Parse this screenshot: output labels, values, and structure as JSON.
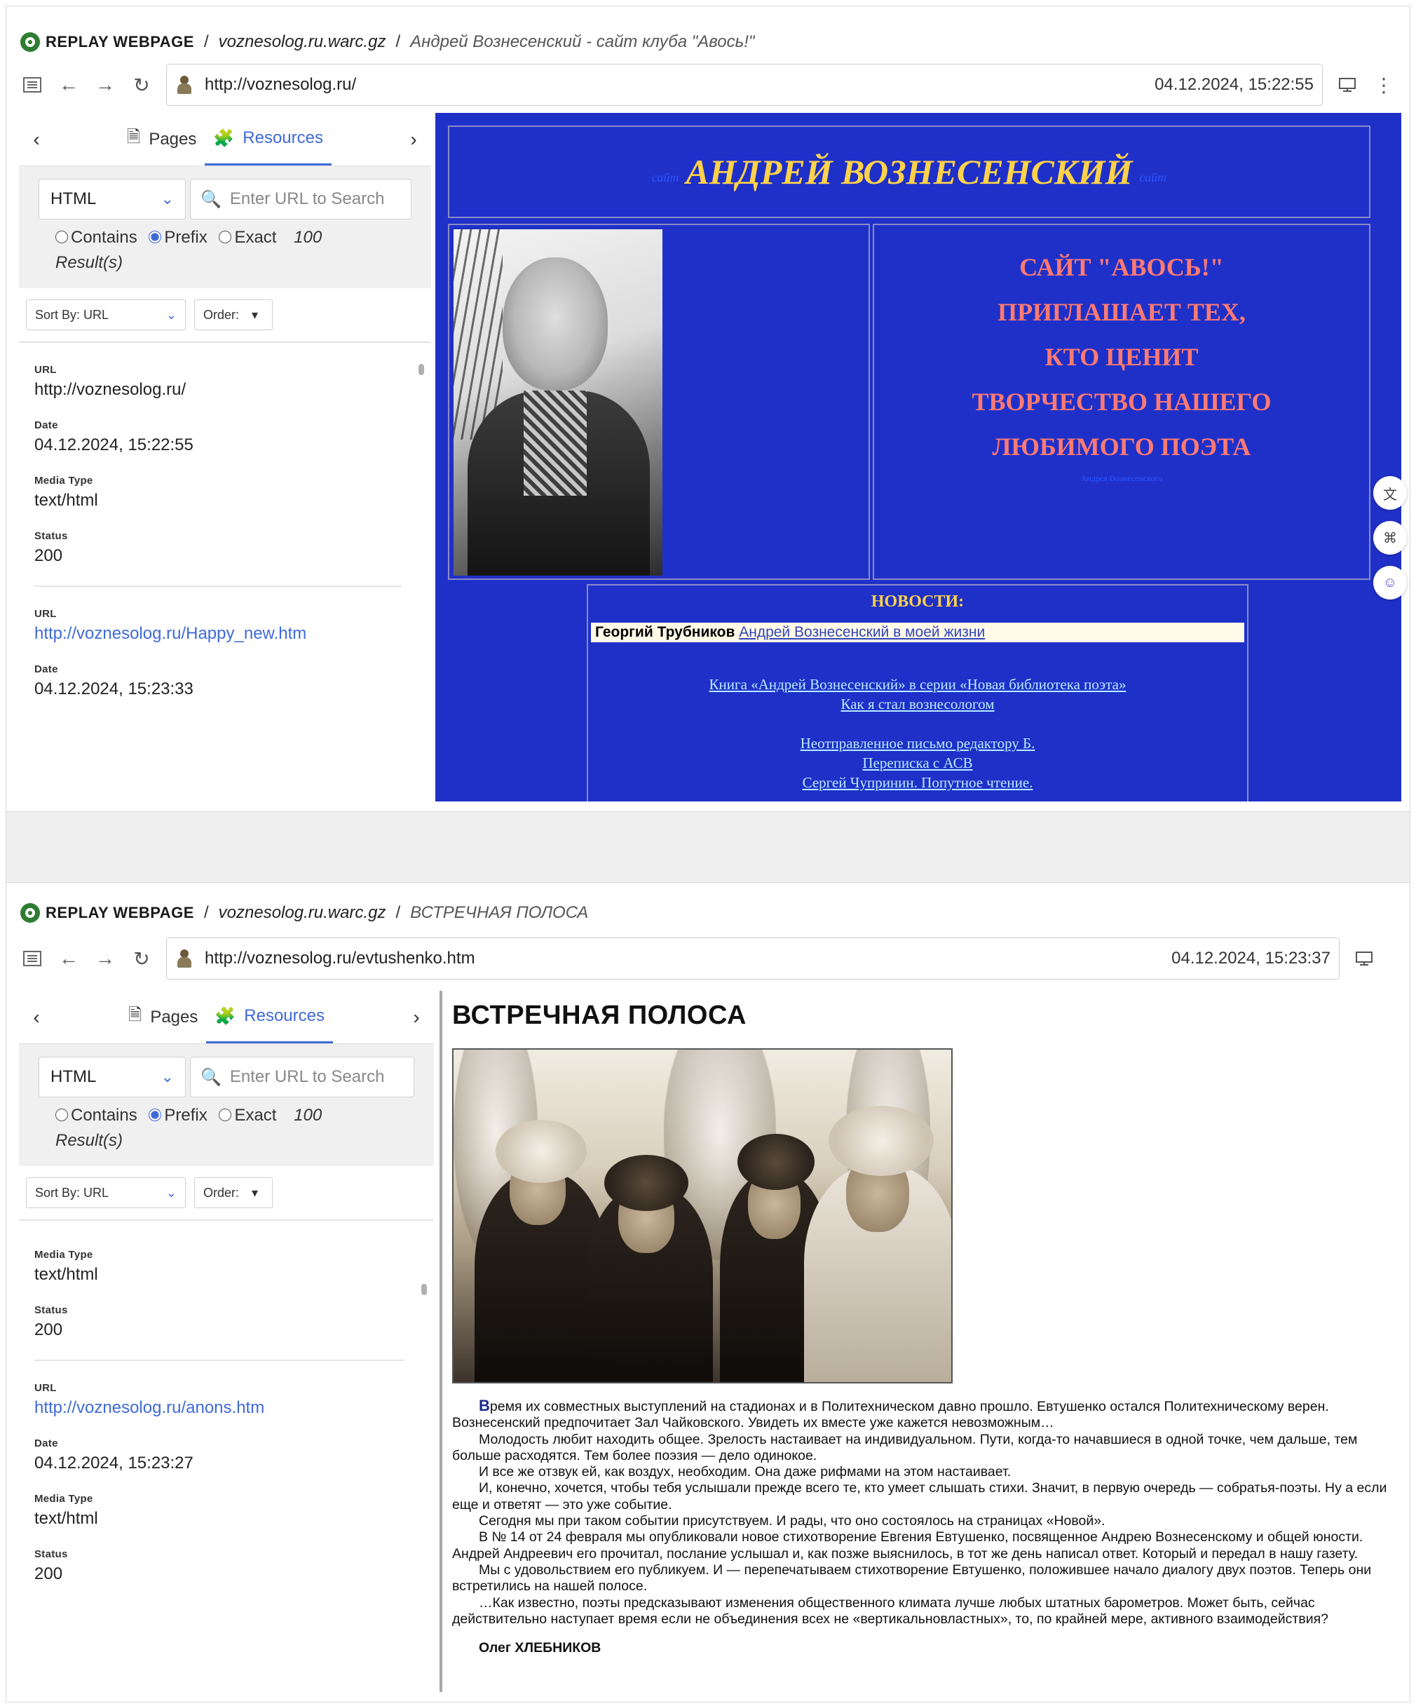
{
  "panels": [
    {
      "brand": "REPLAY WEBPAGE",
      "sep": "/",
      "file": "voznesolog.ru.warc.gz",
      "page_title": "Андрей Вознесенский - сайт клуба \"Авось!\"",
      "url": "http://voznesolog.ru/",
      "timestamp": "04.12.2024, 15:22:55",
      "tabs": {
        "pages": "Pages",
        "resources": "Resources"
      },
      "filter": {
        "type_value": "HTML",
        "search_placeholder": "Enter URL to Search",
        "radio_contains": "Contains",
        "radio_prefix": "Prefix",
        "radio_exact": "Exact",
        "count": "100",
        "results_label": "Result(s)"
      },
      "sort": {
        "sort_by": "Sort By: URL",
        "order": "Order:"
      },
      "results": [
        {
          "url_label": "URL",
          "url": "http://voznesolog.ru/",
          "date_label": "Date",
          "date": "04.12.2024, 15:22:55",
          "media_label": "Media Type",
          "media": "text/html",
          "status_label": "Status",
          "status": "200"
        },
        {
          "url_label": "URL",
          "url": "http://voznesolog.ru/Happy_new.htm",
          "date_label": "Date",
          "date": "04.12.2024, 15:23:33"
        }
      ]
    },
    {
      "brand": "REPLAY WEBPAGE",
      "sep": "/",
      "file": "voznesolog.ru.warc.gz",
      "page_title": "ВСТРЕЧНАЯ ПОЛОСА",
      "url": "http://voznesolog.ru/evtushenko.htm",
      "timestamp": "04.12.2024, 15:23:37",
      "tabs": {
        "pages": "Pages",
        "resources": "Resources"
      },
      "filter": {
        "type_value": "HTML",
        "search_placeholder": "Enter URL to Search",
        "radio_contains": "Contains",
        "radio_prefix": "Prefix",
        "radio_exact": "Exact",
        "count": "100",
        "results_label": "Result(s)"
      },
      "sort": {
        "sort_by": "Sort By: URL",
        "order": "Order:"
      },
      "results": [
        {
          "media_label": "Media Type",
          "media": "text/html",
          "status_label": "Status",
          "status": "200"
        },
        {
          "url_label": "URL",
          "url": "http://voznesolog.ru/anons.htm",
          "date_label": "Date",
          "date": "04.12.2024, 15:23:27",
          "media_label": "Media Type",
          "media": "text/html",
          "status_label": "Status",
          "status": "200"
        }
      ]
    }
  ],
  "site1": {
    "header_small_left": "сайт",
    "header_big": "АНДРЕЙ ВОЗНЕСЕНСКИЙ",
    "header_small_right": "сайт",
    "invite_lines": [
      "САЙТ \"АВОСЬ!\"",
      "ПРИГЛАШАЕТ ТЕХ,",
      "КТО ЦЕНИТ",
      "ТВОРЧЕСТВО НАШЕГО",
      "ЛЮБИМОГО ПОЭТА"
    ],
    "invite_small": "Андрея Вознесенского",
    "news_head": "НОВОСТИ:",
    "featured_author": "Георгий Трубников",
    "featured_link": "Андрей Вознесенский в моей жизни",
    "links": [
      "Книга «Андрей Вознесенский» в серии «Новая библиотека поэта»",
      "Как я стал вознесологом",
      "Неотправленное письмо редактору Б.",
      "Переписка с АСВ",
      "Сергей Чупринин. Попутное чтение."
    ]
  },
  "site2": {
    "title": "ВСТРЕЧНАЯ ПОЛОСА",
    "dropcap": "В",
    "paragraphs": [
      "ремя их совместных выступлений на стадионах и в Политехническом давно прошло. Евтушенко остался Политехническому верен. Вознесенский предпочитает Зал Чайковского. Увидеть их вместе уже кажется невозможным…",
      "Молодость любит находить общее. Зрелость настаивает на индивидуальном. Пути, когда-то начавшиеся в одной точке, чем дальше, тем больше расходятся. Тем более поэзия — дело одинокое.",
      "И все же отзвук ей, как воздух, необходим. Она даже рифмами на этом настаивает.",
      "И, конечно, хочется, чтобы тебя услышали прежде всего те, кто умеет слышать стихи. Значит, в первую очередь — собратья-поэты. Ну а если еще и ответят — это уже событие.",
      "Сегодня мы при таком событии присутствуем. И рады, что оно состоялось на страницах «Новой».",
      "В № 14 от 24 февраля мы опубликовали новое стихотворение Евгения Евтушенко, посвященное Андрею Вознесенскому и общей юности. Андрей Андреевич его прочитал, послание услышал и, как позже выяснилось, в тот же день написал ответ. Который и передал в нашу газету.",
      "Мы с удовольствием его публикуем. И — перепечатываем стихотворение Евтушенко, положившее начало диалогу двух поэтов. Теперь они встретились на нашей полосе.",
      "…Как известно, поэты предсказывают изменения общественного климата лучше любых штатных барометров. Может быть, сейчас действительно наступает время если не объединения всех не «вертикальновластных», то, по крайней мере, активного взаимодействия?"
    ],
    "signature": "Олег ХЛЕБНИКОВ"
  }
}
